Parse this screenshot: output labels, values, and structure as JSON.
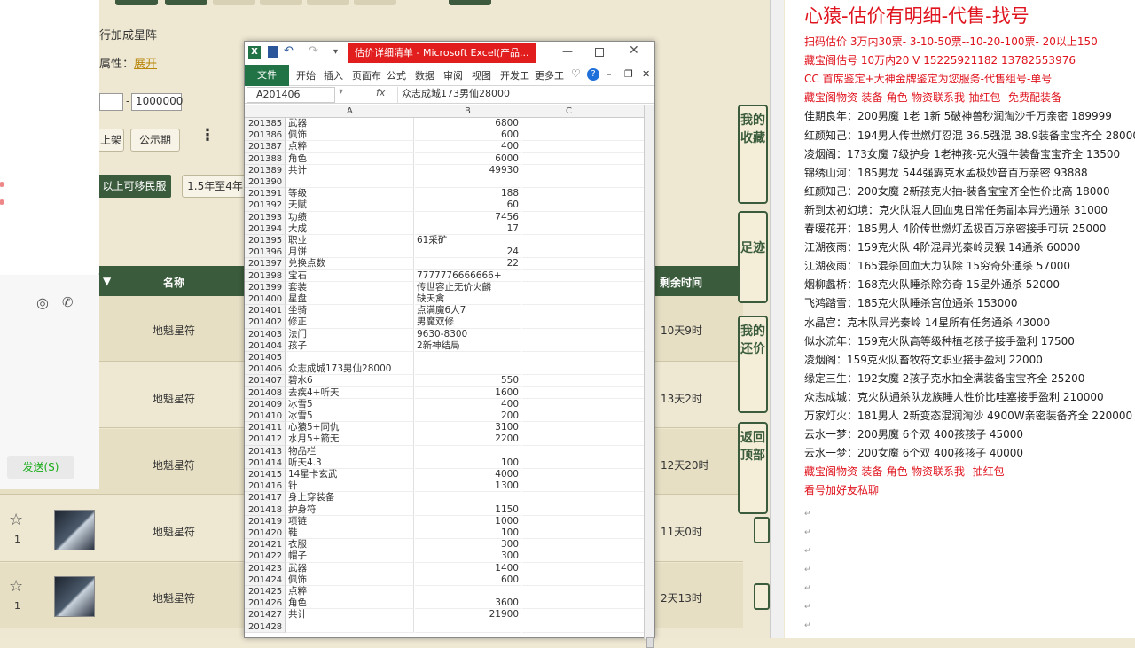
{
  "game": {
    "star_line": "行加成星阵",
    "attr_label": "属性：",
    "attr_link": "展开",
    "price_max": "1000000",
    "price_dash": "-",
    "btn_shelf": "上架",
    "btn_public": "公示期",
    "btn_transfer": "以上可移民服",
    "btn_years": "1.5年至4年",
    "table_headers": {
      "name": "名称",
      "time": "剩余时间"
    },
    "rows": [
      {
        "name": "地魁星符",
        "time": "10天9时",
        "fav": ""
      },
      {
        "name": "地魁星符",
        "time": "13天2时",
        "fav": ""
      },
      {
        "name": "地魁星符",
        "time": "12天20时",
        "fav": ""
      },
      {
        "name": "地魁星符",
        "time": "11天0时",
        "fav": "1"
      },
      {
        "name": "地魁星符",
        "time": "2天13时",
        "fav": "1"
      }
    ],
    "side_nav": [
      "我的收藏",
      "足迹",
      "我的还价",
      "返回顶部"
    ]
  },
  "chat": {
    "send_label": "发送(S)"
  },
  "excel": {
    "title": "估价详细清单 - Microsoft Excel(产品...",
    "tabs": [
      "文件",
      "开始",
      "插入",
      "页面布",
      "公式",
      "数据",
      "审阅",
      "视图",
      "开发工",
      "更多工"
    ],
    "name_box": "A201406",
    "formula": "众志成城173男仙28000",
    "col_headers": [
      "A",
      "B",
      "C"
    ],
    "rows": [
      {
        "n": "201385",
        "a": "武器",
        "b": "6800"
      },
      {
        "n": "201386",
        "a": "佩饰",
        "b": "600"
      },
      {
        "n": "201387",
        "a": "点粹",
        "b": "400"
      },
      {
        "n": "201388",
        "a": "角色",
        "b": "6000"
      },
      {
        "n": "201389",
        "a": "共计",
        "b": "49930"
      },
      {
        "n": "201390",
        "a": "",
        "b": ""
      },
      {
        "n": "201391",
        "a": "等级",
        "b": "188"
      },
      {
        "n": "201392",
        "a": "天赋",
        "b": "60"
      },
      {
        "n": "201393",
        "a": "功绩",
        "b": "7456"
      },
      {
        "n": "201394",
        "a": "大成",
        "b": "17"
      },
      {
        "n": "201395",
        "a": "职业",
        "b": "61采矿",
        "t": 1
      },
      {
        "n": "201396",
        "a": "月饼",
        "b": "24"
      },
      {
        "n": "201397",
        "a": "兑换点数",
        "b": "22"
      },
      {
        "n": "201398",
        "a": "宝石",
        "b": "7777776666666+",
        "t": 1
      },
      {
        "n": "201399",
        "a": "套装",
        "b": "传世容止无价火麟",
        "t": 1
      },
      {
        "n": "201400",
        "a": "星盘",
        "b": "缺天禽",
        "t": 1
      },
      {
        "n": "201401",
        "a": "坐骑",
        "b": "点满魔6人7",
        "t": 1
      },
      {
        "n": "201402",
        "a": "修正",
        "b": "男魔双修",
        "t": 1
      },
      {
        "n": "201403",
        "a": "法门",
        "b": "9630-8300",
        "t": 1
      },
      {
        "n": "201404",
        "a": "孩子",
        "b": "2新神结局",
        "t": 1
      },
      {
        "n": "201405",
        "a": "",
        "b": ""
      },
      {
        "n": "201406",
        "a": "众志成城173男仙28000",
        "b": ""
      },
      {
        "n": "201407",
        "a": "碧水6",
        "b": "550"
      },
      {
        "n": "201408",
        "a": "去疾4+听天",
        "b": "1600"
      },
      {
        "n": "201409",
        "a": "冰雪5",
        "b": "400"
      },
      {
        "n": "201410",
        "a": "冰雪5",
        "b": "200"
      },
      {
        "n": "201411",
        "a": "心猿5+同仇",
        "b": "3100"
      },
      {
        "n": "201412",
        "a": "水月5+箭无",
        "b": "2200"
      },
      {
        "n": "201413",
        "a": "物品栏",
        "b": ""
      },
      {
        "n": "201414",
        "a": "听天4.3",
        "b": "100"
      },
      {
        "n": "201415",
        "a": "14星卡玄武",
        "b": "4000"
      },
      {
        "n": "201416",
        "a": "针",
        "b": "1300"
      },
      {
        "n": "201417",
        "a": "身上穿装备",
        "b": ""
      },
      {
        "n": "201418",
        "a": "护身符",
        "b": "1150"
      },
      {
        "n": "201419",
        "a": "项链",
        "b": "1000"
      },
      {
        "n": "201420",
        "a": "鞋",
        "b": "100"
      },
      {
        "n": "201421",
        "a": "衣服",
        "b": "300"
      },
      {
        "n": "201422",
        "a": "帽子",
        "b": "300"
      },
      {
        "n": "201423",
        "a": "武器",
        "b": "1400"
      },
      {
        "n": "201424",
        "a": "佩饰",
        "b": "600"
      },
      {
        "n": "201425",
        "a": "点粹",
        "b": ""
      },
      {
        "n": "201426",
        "a": "角色",
        "b": "3600"
      },
      {
        "n": "201427",
        "a": "共计",
        "b": "21900"
      },
      {
        "n": "201428",
        "a": "",
        "b": ""
      }
    ]
  },
  "notes": {
    "title": "心猿-估价有明细-代售-找号",
    "lines": [
      {
        "t": "扫码估价 3万内30票- 3-10-50票--10-20-100票- 20以上150",
        "c": "red"
      },
      {
        "t": "藏宝阁估号 10万内20 V 15225921182   13782553976",
        "c": "red"
      },
      {
        "t": "CC 首席鉴定+大神金牌鉴定为您服务-代售组号-单号",
        "c": "red"
      },
      {
        "t": "藏宝阁物资-装备-角色-物资联系我-抽红包--免费配装备",
        "c": "red"
      },
      {
        "t": "佳期良年：200男魔 1老 1新 5破神兽秒润淘沙千万亲密 189999",
        "c": "dark"
      },
      {
        "t": "红颜知己：194男人传世燃灯忍混 36.5强混 38.9装备宝宝齐全 28000",
        "c": "dark"
      },
      {
        "t": "凌烟阁：173女魔 7级护身 1老神孩-克火强牛装备宝宝齐全 13500",
        "c": "dark"
      },
      {
        "t": "锦绣山河：185男龙 544强霹克水孟极妙音百万亲密 93888",
        "c": "dark"
      },
      {
        "t": "红颜知己：200女魔 2新孩克火抽-装备宝宝齐全性价比高 18000",
        "c": "dark"
      },
      {
        "t": "新到太初幻境：克火队混人回血鬼日常任务副本异光通杀 31000",
        "c": "dark"
      },
      {
        "t": "春暖花开：185男人 4阶传世燃灯孟极百万亲密接手可玩 25000",
        "c": "dark"
      },
      {
        "t": "江湖夜雨：159克火队 4阶混异光秦岭灵猴 14通杀 60000",
        "c": "dark"
      },
      {
        "t": "江湖夜雨：165混杀回血大力队除 15穷奇外通杀 57000",
        "c": "dark"
      },
      {
        "t": "烟柳蠡桥：168克火队睡杀除穷奇 15星外通杀 52000",
        "c": "dark"
      },
      {
        "t": "飞鸿踏雪：185克火队睡杀宫位通杀 153000",
        "c": "dark"
      },
      {
        "t": "水晶宫：克木队异光秦岭 14星所有任务通杀 43000",
        "c": "dark"
      },
      {
        "t": "似水流年：159克火队高等级种植老孩子接手盈利 17500",
        "c": "dark"
      },
      {
        "t": "凌烟阁：159克火队畜牧符文职业接手盈利 22000",
        "c": "dark"
      },
      {
        "t": "缘定三生：192女魔 2孩子克水抽全满装备宝宝齐全 25200",
        "c": "dark"
      },
      {
        "t": "众志成城：克火队通杀队龙族睡人性价比哇塞接手盈利 210000",
        "c": "dark"
      },
      {
        "t": "万家灯火：181男人 2新变态混润淘沙 4900W亲密装备齐全 220000",
        "c": "dark"
      },
      {
        "t": "云水一梦：200男魔 6个双 400孩孩子 45000",
        "c": "dark"
      },
      {
        "t": "云水一梦：200女魔 6个双 400孩孩子 40000",
        "c": "dark"
      },
      {
        "t": "藏宝阁物资-装备-角色-物资联系我--抽红包",
        "c": "red"
      },
      {
        "t": "看号加好友私聊",
        "c": "red"
      }
    ]
  }
}
